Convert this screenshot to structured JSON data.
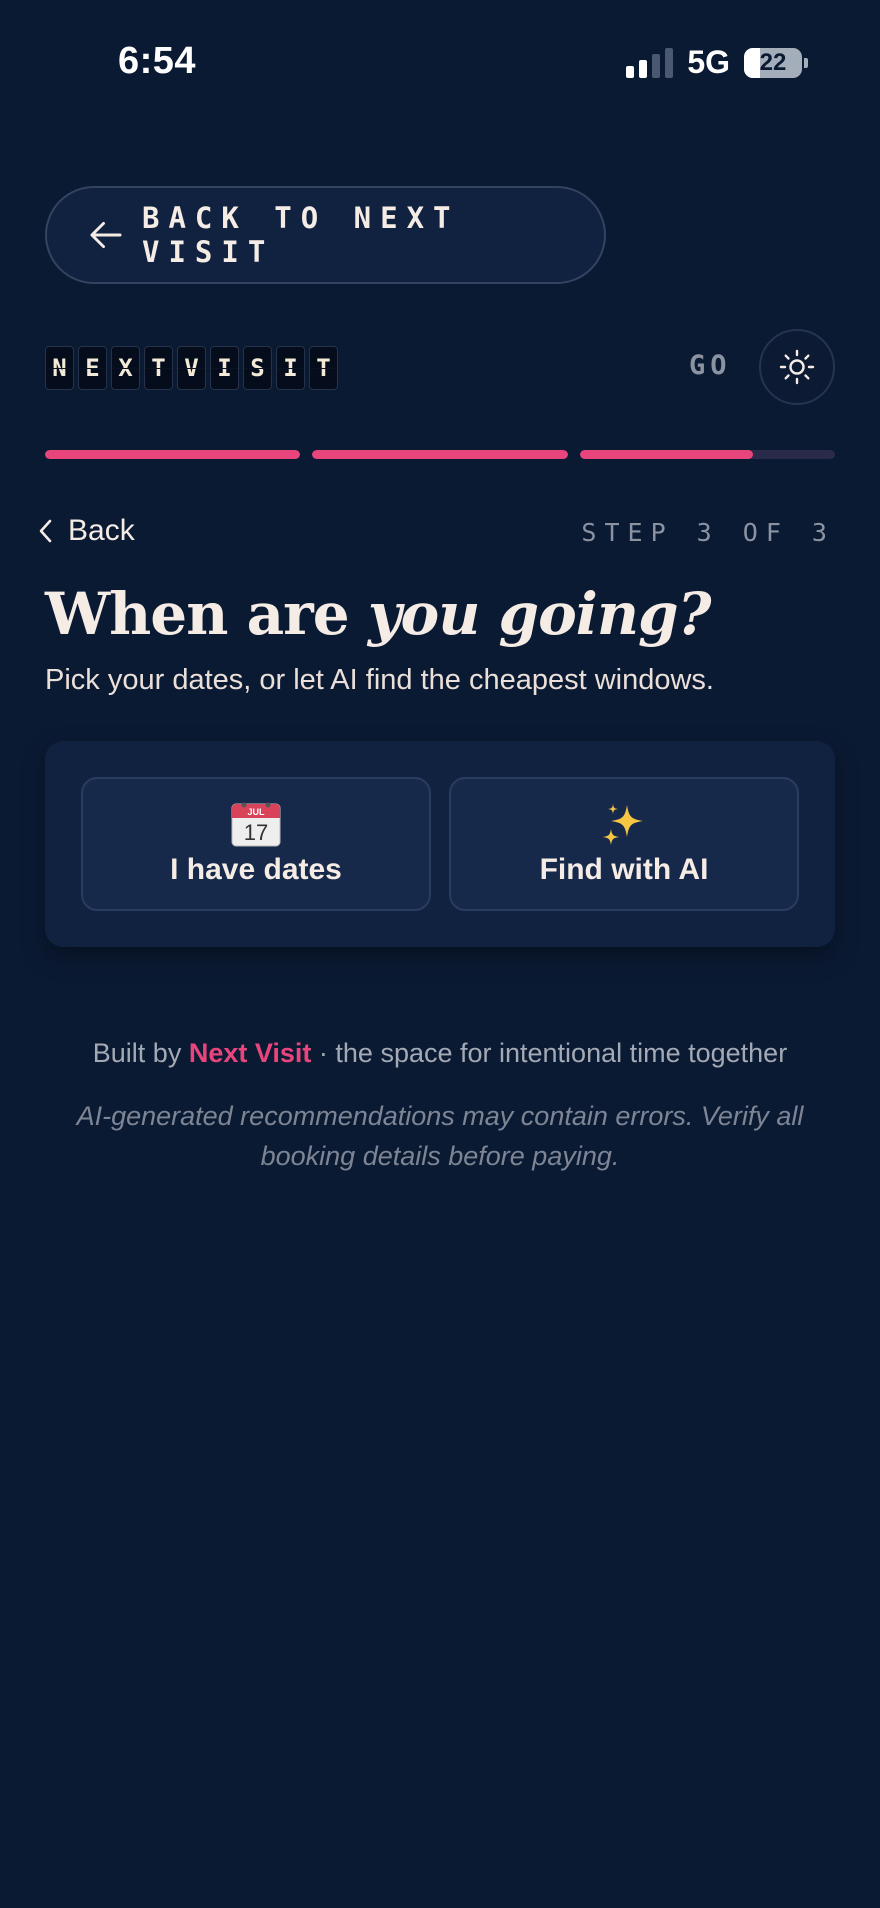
{
  "status_bar": {
    "time": "6:54",
    "network": "5G",
    "battery": "22"
  },
  "back_pill": {
    "label": "BACK TO NEXT VISIT",
    "icon": "arrow-left-icon"
  },
  "brand": {
    "letters": [
      "N",
      "E",
      "X",
      "T",
      "V",
      "I",
      "S",
      "I",
      "T"
    ],
    "go_label": "GO",
    "theme_icon": "sun-icon"
  },
  "progress": {
    "segments": [
      1.0,
      1.0,
      0.68
    ],
    "color": "#e8457c"
  },
  "nav": {
    "back_label": "Back",
    "step_label": "STEP 3 OF 3"
  },
  "heading": {
    "plain": "When are",
    "italic": "you going?"
  },
  "subtitle": "Pick your dates, or let AI find the cheapest windows.",
  "options": [
    {
      "icon": "calendar-icon",
      "calendar_month": "JUL",
      "calendar_day": "17",
      "label": "I have dates"
    },
    {
      "icon": "sparkles-icon",
      "label": "Find with AI"
    }
  ],
  "footer": {
    "prefix": "Built by",
    "brand": "Next Visit",
    "suffix": "· the space for intentional time together",
    "disclaimer": "AI-generated recommendations may contain errors. Verify all booking details before paying."
  },
  "colors": {
    "background": "#0b1a33",
    "accent": "#e8457c",
    "card": "#10223f"
  }
}
